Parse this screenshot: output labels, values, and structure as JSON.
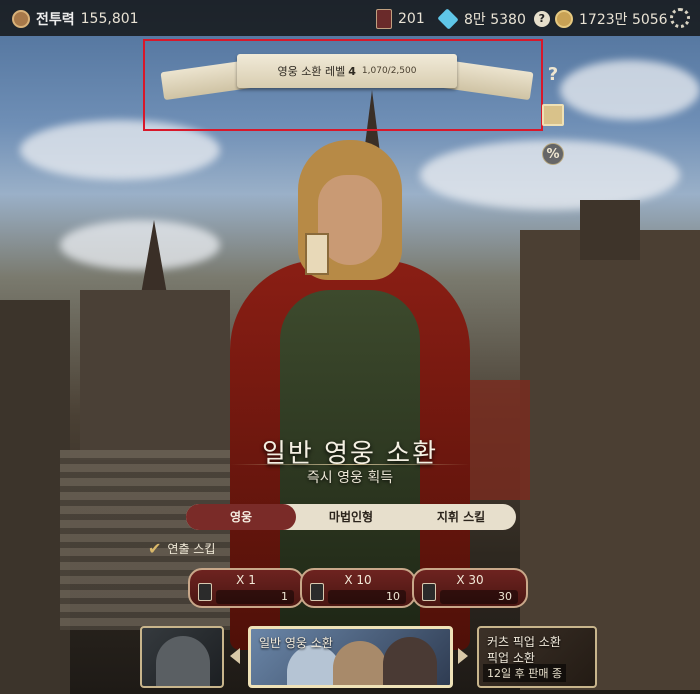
{
  "topbar": {
    "power_label": "전투력",
    "power_value": "155,801",
    "cards": "201",
    "gems": "8만 5380",
    "gold": "1723만 5056"
  },
  "summon_level": {
    "label": "영웅 소환 레벨",
    "level": "4",
    "xp": "1,070/2,500"
  },
  "side_icons": {
    "help": "?",
    "percent": "%"
  },
  "title": "일반 영웅 소환",
  "subtitle": "즉시 영웅 획득",
  "tabs": [
    {
      "label": "영웅",
      "active": true
    },
    {
      "label": "마법인형",
      "active": false
    },
    {
      "label": "지휘 스킬",
      "active": false
    }
  ],
  "skip_label": "연출 스킵",
  "summon_buttons": [
    {
      "label": "X 1",
      "cost": "1"
    },
    {
      "label": "X 10",
      "cost": "10"
    },
    {
      "label": "X 30",
      "cost": "30"
    }
  ],
  "carousel": {
    "mid_title": "일반 영웅 소환",
    "right_title_1": "커츠 픽업 소환",
    "right_title_2": "픽업 소환",
    "right_sub": "12일 후 판매 종"
  },
  "colors": {
    "accent": "#7a2b28",
    "highlight": "#d8182a",
    "parchment": "#e7dfcc"
  }
}
